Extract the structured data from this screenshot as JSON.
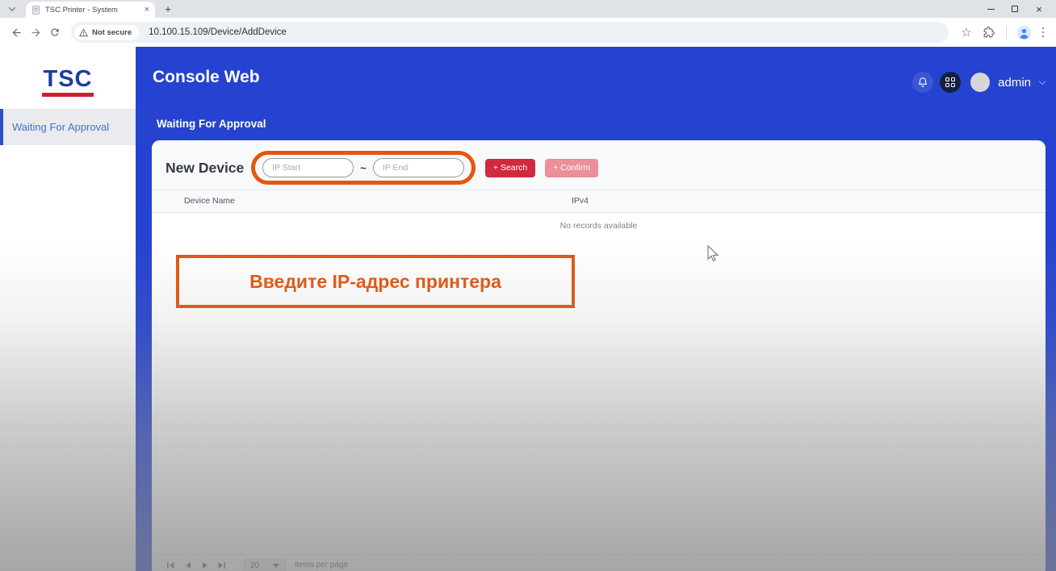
{
  "browser": {
    "tab_title": "TSC Printer - System",
    "url": "10.100.15.109/Device/AddDevice",
    "not_secure_label": "Not secure"
  },
  "sidebar": {
    "logo_text": "TSC",
    "nav": [
      {
        "label": "Waiting For Approval",
        "active": true
      }
    ]
  },
  "header": {
    "app_title": "Console Web",
    "username": "admin"
  },
  "content": {
    "subtitle": "Waiting For Approval"
  },
  "new_device": {
    "title": "New Device",
    "ip_start_placeholder": "IP Start",
    "ip_end_placeholder": "IP End",
    "range_separator": "~",
    "search_label": "+ Search",
    "confirm_label": "+ Confirm"
  },
  "table": {
    "columns": [
      "Device Name",
      "IPv4"
    ],
    "empty_message": "No records available"
  },
  "annotation": {
    "text": "Введите IP-адрес принтера"
  },
  "pager": {
    "page_size": "20",
    "per_page_label": "items per page"
  },
  "colors": {
    "header_blue": "#2543d0",
    "accent_red": "#d1293d",
    "confirm_pink": "#ec8f9b",
    "highlight_orange": "#e4570f",
    "logo_blue": "#1b3f9b",
    "logo_red": "#ce2030",
    "nav_link_blue": "#4273cc"
  }
}
